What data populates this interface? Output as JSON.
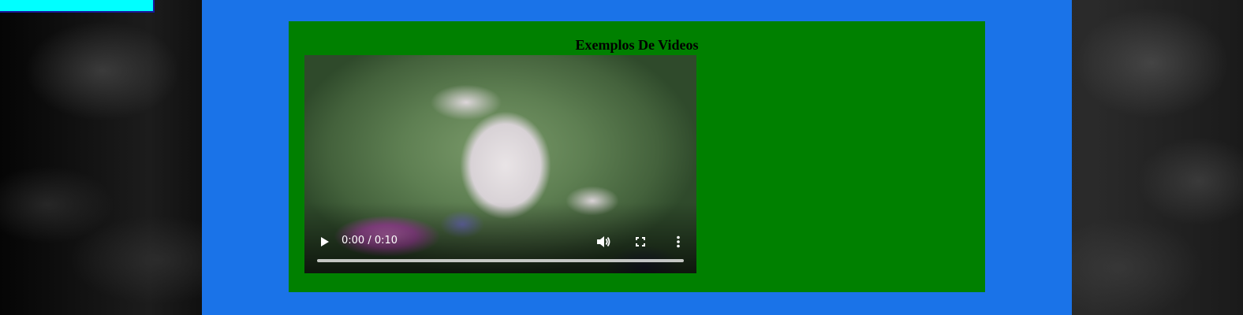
{
  "page": {
    "section_title": "Exemplos De Videos"
  },
  "video": {
    "current_time": "0:00",
    "duration": "0:10",
    "progress_fraction": 0,
    "controls": {
      "play_icon": "play-icon",
      "volume_icon": "volume-icon",
      "fullscreen_icon": "fullscreen-icon",
      "more_icon": "more-vert-icon"
    }
  },
  "colors": {
    "main_column": "#1a73e8",
    "panel": "#008000",
    "corner_box": "#00ffff"
  }
}
